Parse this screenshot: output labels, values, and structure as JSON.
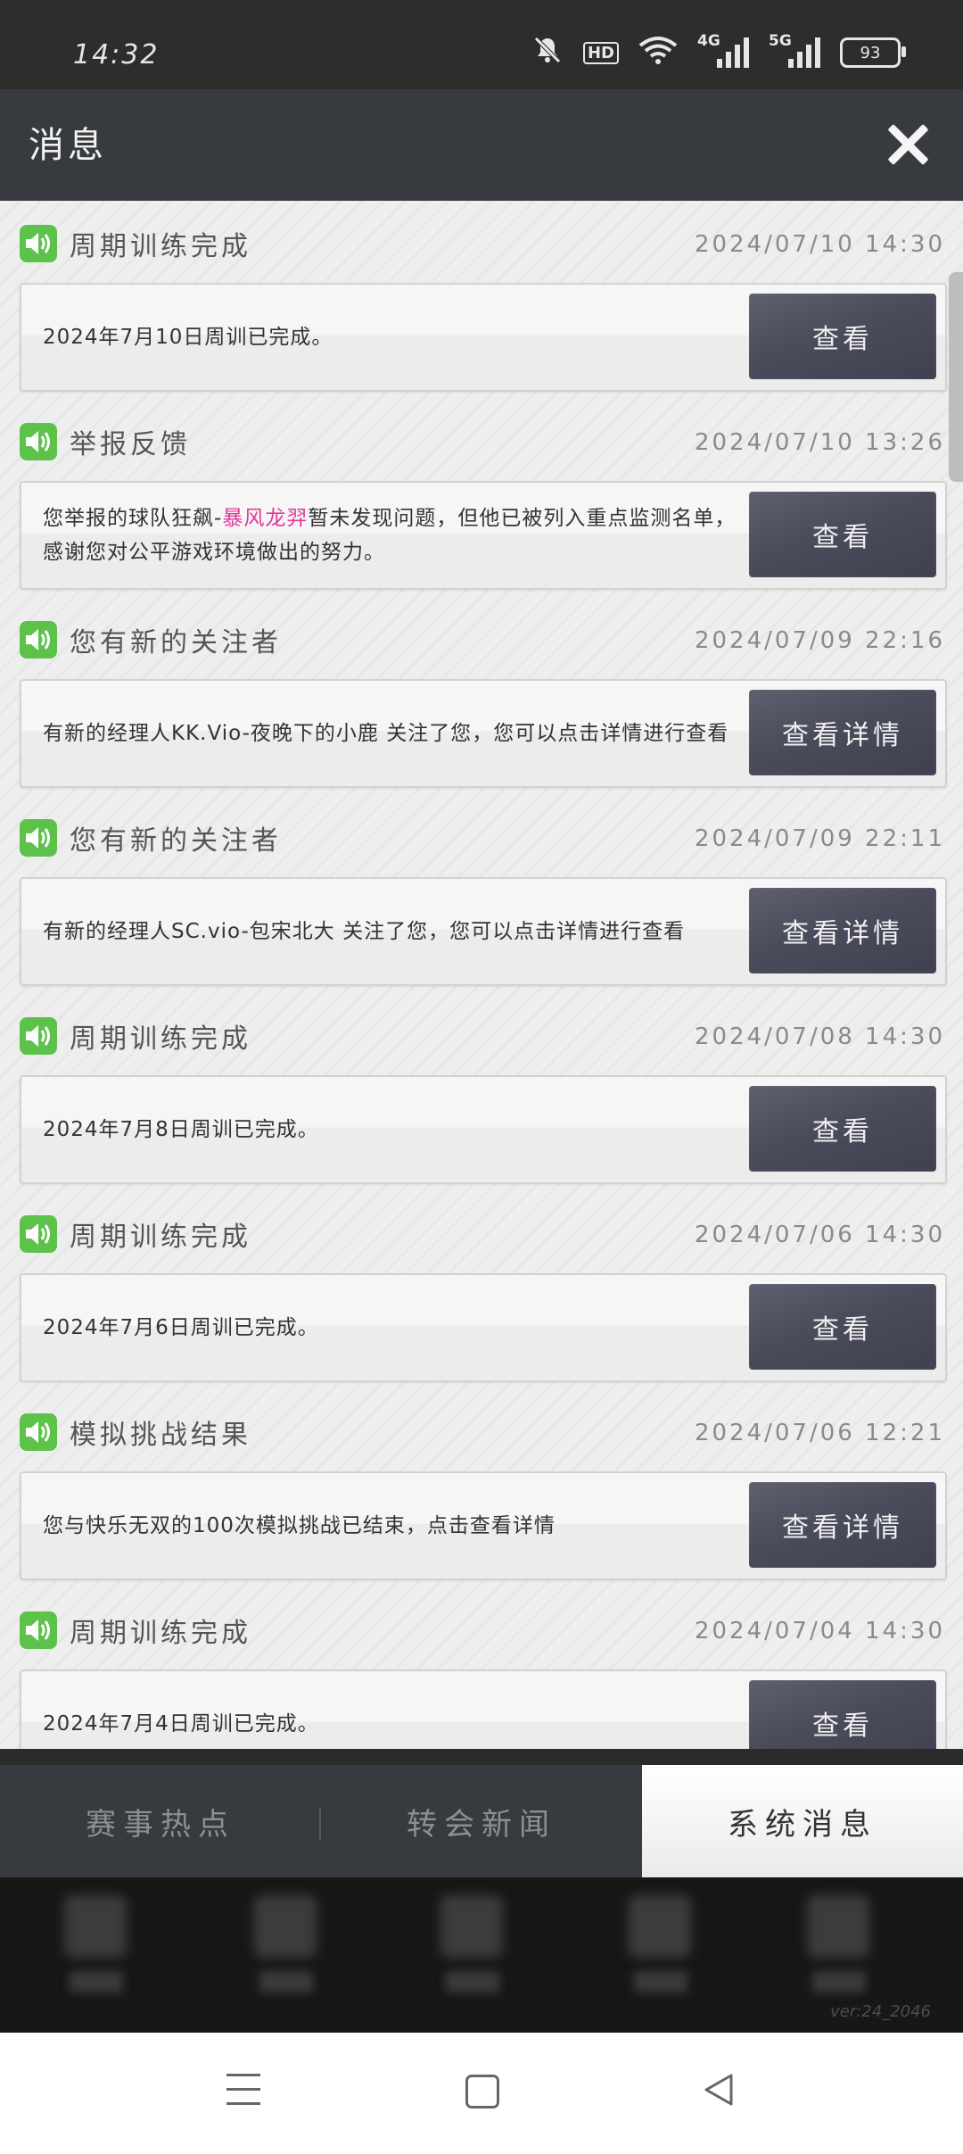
{
  "status_bar": {
    "time": "14:32",
    "hd_label": "HD",
    "net1_label": "4G",
    "net2_label": "5G",
    "battery": "93"
  },
  "header": {
    "title": "消息"
  },
  "messages": [
    {
      "title": "周期训练完成",
      "time": "2024/07/10 14:30",
      "text_before": "2024年7月10日周训已完成。",
      "highlight": "",
      "text_after": "",
      "button": "查看"
    },
    {
      "title": "举报反馈",
      "time": "2024/07/10 13:26",
      "text_before": "您举报的球队狂飙-",
      "highlight": "暴风龙羿",
      "text_after": "暂未发现问题，但他已被列入重点监测名单，感谢您对公平游戏环境做出的努力。",
      "button": "查看"
    },
    {
      "title": "您有新的关注者",
      "time": "2024/07/09 22:16",
      "text_before": "有新的经理人KK.Vio-夜晚下的小鹿 关注了您，您可以点击详情进行查看",
      "highlight": "",
      "text_after": "",
      "button": "查看详情"
    },
    {
      "title": "您有新的关注者",
      "time": "2024/07/09 22:11",
      "text_before": "有新的经理人SC.vio-包宋北大 关注了您，您可以点击详情进行查看",
      "highlight": "",
      "text_after": "",
      "button": "查看详情"
    },
    {
      "title": "周期训练完成",
      "time": "2024/07/08 14:30",
      "text_before": "2024年7月8日周训已完成。",
      "highlight": "",
      "text_after": "",
      "button": "查看"
    },
    {
      "title": "周期训练完成",
      "time": "2024/07/06 14:30",
      "text_before": "2024年7月6日周训已完成。",
      "highlight": "",
      "text_after": "",
      "button": "查看"
    },
    {
      "title": "模拟挑战结果",
      "time": "2024/07/06 12:21",
      "text_before": "您与快乐无双的100次模拟挑战已结束，点击查看详情",
      "highlight": "",
      "text_after": "",
      "button": "查看详情"
    },
    {
      "title": "周期训练完成",
      "time": "2024/07/04 14:30",
      "text_before": "2024年7月4日周训已完成。",
      "highlight": "",
      "text_after": "",
      "button": "查看"
    }
  ],
  "tabs": [
    {
      "label": "赛事热点",
      "active": false
    },
    {
      "label": "转会新闻",
      "active": false
    },
    {
      "label": "系统消息",
      "active": true
    }
  ],
  "version": "ver:24_2046",
  "colors": {
    "accent_green": "#5cc24a",
    "highlight_pink": "#e0399a",
    "button_bg": "#4a4c5c"
  }
}
